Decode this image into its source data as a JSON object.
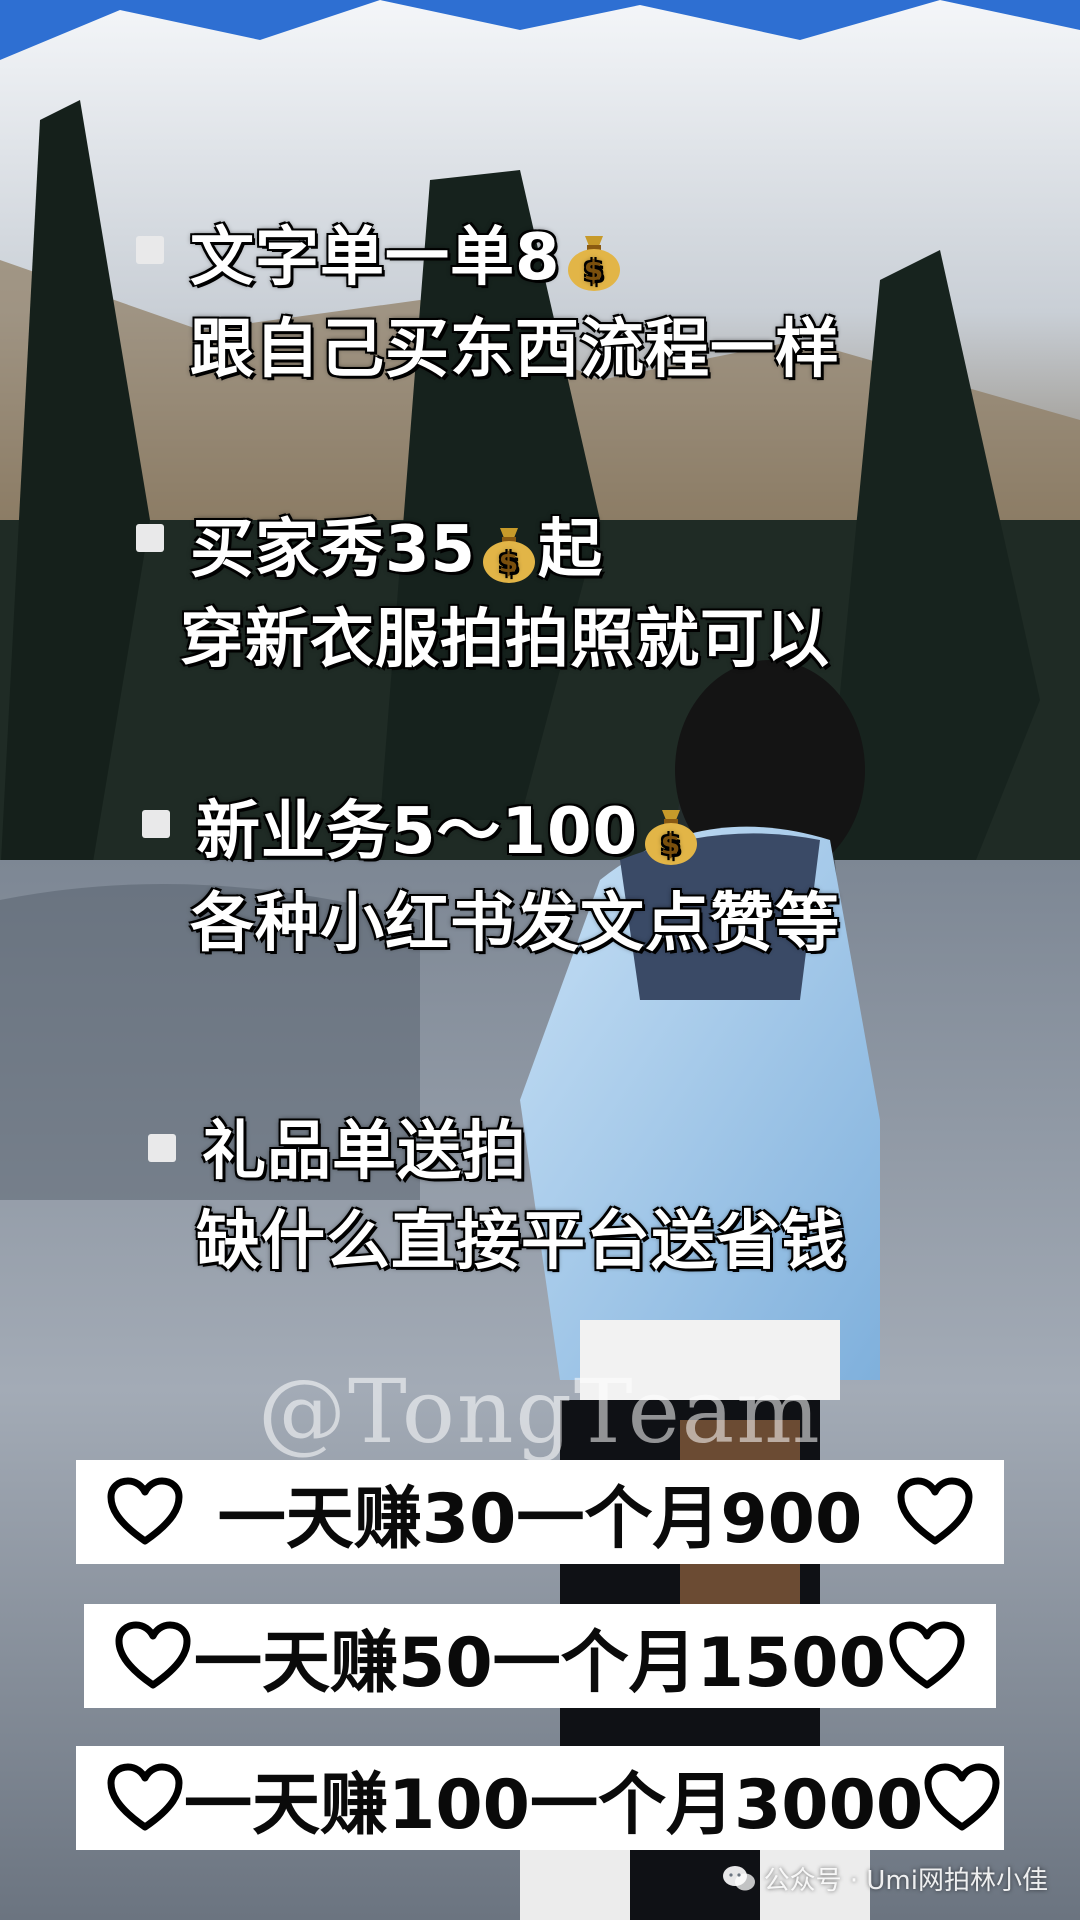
{
  "items": [
    {
      "line1": "文字单一单8",
      "line2": "跟自己买东西流程一样"
    },
    {
      "line1a": "买家秀35",
      "line1b": "起",
      "line2": "穿新衣服拍拍照就可以"
    },
    {
      "line1": "新业务5～100",
      "line2": "各种小红书发文点赞等"
    },
    {
      "line1": "礼品单送拍",
      "line2": "缺什么直接平台送省钱"
    }
  ],
  "watermark": "@TongTeam",
  "bars": [
    {
      "text": "一天赚30一个月900"
    },
    {
      "text": "一天赚50一个月1500"
    },
    {
      "text": "一天赚100一个月3000"
    }
  ],
  "footer": {
    "text": "公众号 · Umi网拍林小佳",
    "icon": "wechat-icon"
  },
  "colors": {
    "bar_bg": "#ffffff",
    "text": "#ffffff",
    "bar_text": "#0a0a0a"
  }
}
